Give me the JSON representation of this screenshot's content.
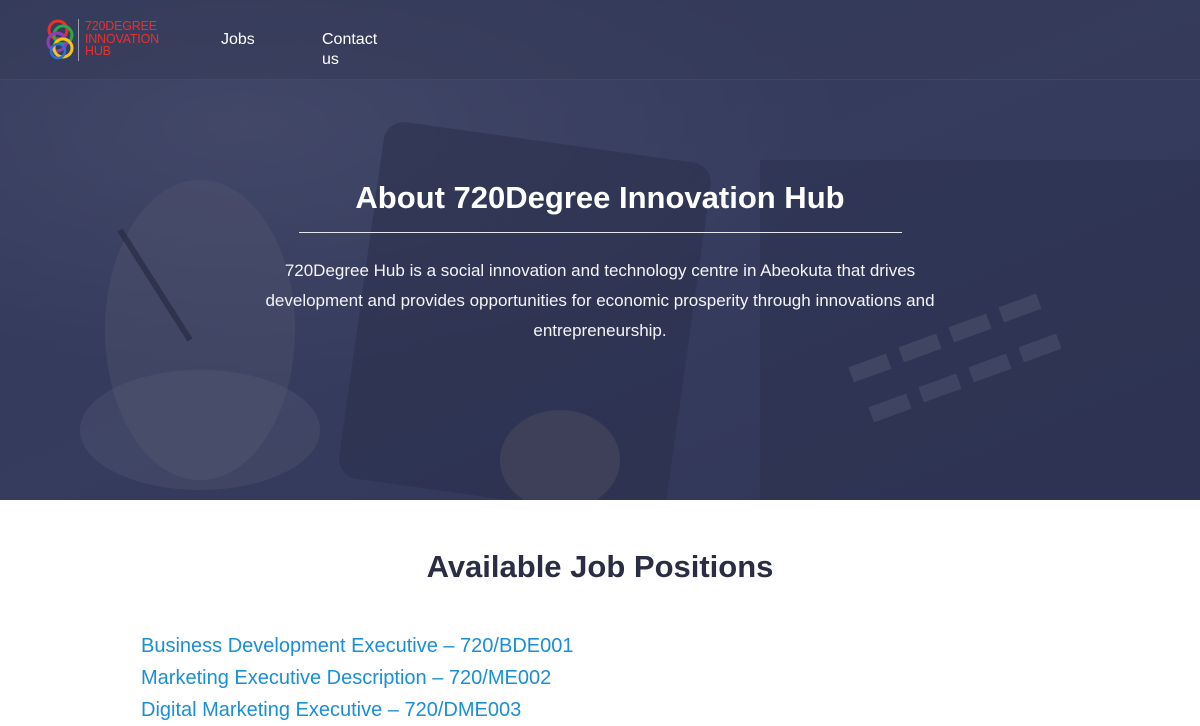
{
  "header": {
    "logo": {
      "lines": [
        "720DEGREE",
        "INNOVATION",
        "HUB"
      ],
      "icon": "interlocked-rings-logo-icon",
      "colors": [
        "#e8312f",
        "#f5c518",
        "#2aa84a",
        "#2f6fd6",
        "#8e3fb8"
      ]
    },
    "nav": [
      {
        "label": "Jobs"
      },
      {
        "label": "Contact us"
      }
    ]
  },
  "hero": {
    "title": "About 720Degree Innovation Hub",
    "description": "720Degree Hub is a social innovation and technology centre in Abeokuta that drives development and provides opportunities for economic prosperity through innovations and entrepreneurship."
  },
  "jobs": {
    "heading": "Available Job Positions",
    "items": [
      {
        "label": "Business Development Executive – 720/BDE001"
      },
      {
        "label": "Marketing Executive Description – 720/ME002"
      },
      {
        "label": "Digital Marketing Executive – 720/DME003"
      }
    ]
  },
  "colors": {
    "link": "#1a8fd6",
    "heading": "#2b2d45",
    "overlay": "#2a3052"
  }
}
